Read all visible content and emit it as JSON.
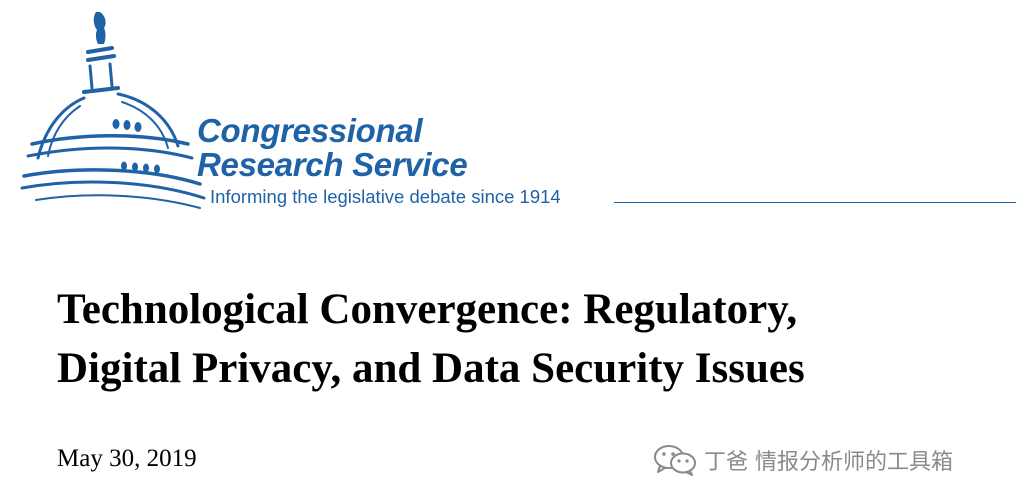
{
  "header": {
    "org_line1": "Congressional",
    "org_line2": "Research Service",
    "tagline": "Informing the legislative debate since 1914",
    "brand_color": "#1f62a8",
    "logo_icon": "capitol-dome-icon"
  },
  "document": {
    "title_line1": "Technological Convergence: Regulatory,",
    "title_line2": "Digital Privacy, and Data Security Issues",
    "date": "May 30, 2019"
  },
  "watermark": {
    "icon": "wechat-icon",
    "text": "丁爸 情报分析师的工具箱"
  }
}
